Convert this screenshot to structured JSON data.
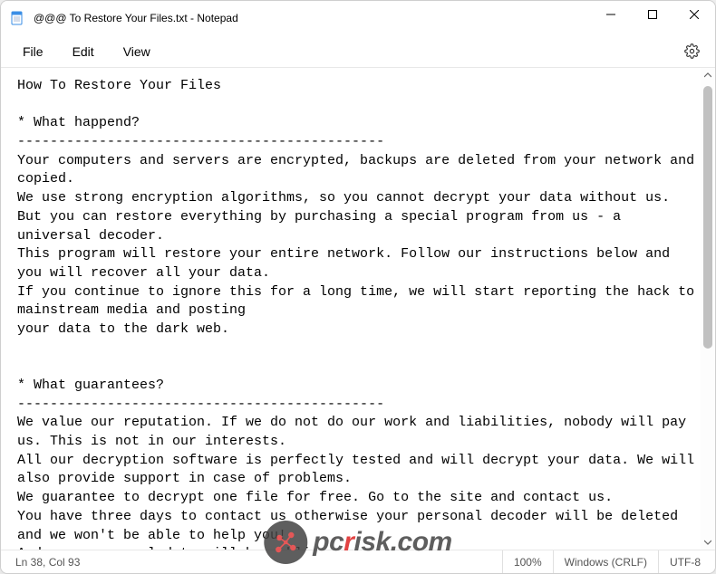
{
  "titlebar": {
    "title": "@@@ To Restore Your Files.txt - Notepad"
  },
  "menu": {
    "file": "File",
    "edit": "Edit",
    "view": "View"
  },
  "content": "How To Restore Your Files\n\n* What happend?\n---------------------------------------------\nYour computers and servers are encrypted, backups are deleted from your network and copied.\nWe use strong encryption algorithms, so you cannot decrypt your data without us.\nBut you can restore everything by purchasing a special program from us - a universal decoder.\nThis program will restore your entire network. Follow our instructions below and you will recover all your data.\nIf you continue to ignore this for a long time, we will start reporting the hack to mainstream media and posting\nyour data to the dark web.\n\n\n* What guarantees?\n---------------------------------------------\nWe value our reputation. If we do not do our work and liabilities, nobody will pay us. This is not in our interests.\nAll our decryption software is perfectly tested and will decrypt your data. We will also provide support in case of problems.\nWe guarantee to decrypt one file for free. Go to the site and contact us.\nYou have three days to contact us otherwise your personal decoder will be deleted and we won't be able to help you!\nAnd your personal data will be public.",
  "statusbar": {
    "position": "Ln 38, Col 93",
    "zoom": "100%",
    "line_ending": "Windows (CRLF)",
    "encoding": "UTF-8"
  },
  "watermark": {
    "prefix": "pc",
    "highlight": "r",
    "suffix": "isk.com"
  }
}
